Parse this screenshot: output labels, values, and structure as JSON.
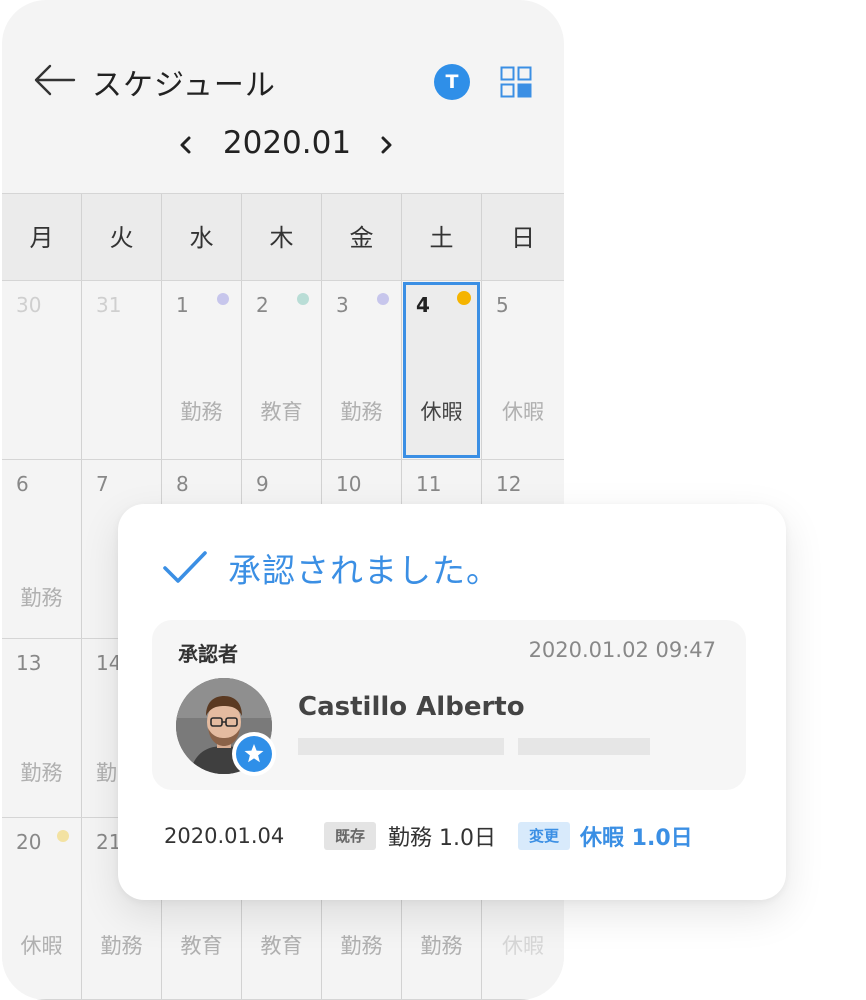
{
  "header": {
    "title": "スケジュール",
    "avatar_letter": "T"
  },
  "month": {
    "label": "2020.01"
  },
  "weekdays": [
    "月",
    "火",
    "水",
    "木",
    "金",
    "土",
    "日"
  ],
  "weeks": [
    {
      "days": [
        {
          "num": "30",
          "label": ""
        },
        {
          "num": "31",
          "label": ""
        },
        {
          "num": "1",
          "label": "勤務",
          "dot": "#c7c6ec"
        },
        {
          "num": "2",
          "label": "教育",
          "dot": "#b9ddd6"
        },
        {
          "num": "3",
          "label": "勤務",
          "dot": "#c7c6ec"
        },
        {
          "num": "4",
          "label": "休暇",
          "dot": "#f5b400",
          "selected": true
        },
        {
          "num": "5",
          "label": "休暇"
        }
      ]
    },
    {
      "days": [
        {
          "num": "6",
          "label": "勤務"
        },
        {
          "num": "7",
          "label": ""
        },
        {
          "num": "8",
          "label": ""
        },
        {
          "num": "9",
          "label": ""
        },
        {
          "num": "10",
          "label": ""
        },
        {
          "num": "11",
          "label": ""
        },
        {
          "num": "12",
          "label": ""
        }
      ]
    },
    {
      "days": [
        {
          "num": "13",
          "label": "勤務"
        },
        {
          "num": "14",
          "label": "勤"
        },
        {
          "num": "",
          "label": ""
        },
        {
          "num": "",
          "label": ""
        },
        {
          "num": "",
          "label": ""
        },
        {
          "num": "",
          "label": ""
        },
        {
          "num": "",
          "label": ""
        }
      ]
    },
    {
      "days": [
        {
          "num": "20",
          "label": "休暇",
          "dot": "#f3e2a2"
        },
        {
          "num": "21",
          "label": "勤務"
        },
        {
          "num": "",
          "label": "教育"
        },
        {
          "num": "",
          "label": "教育"
        },
        {
          "num": "",
          "label": "勤務"
        },
        {
          "num": "",
          "label": "勤務"
        },
        {
          "num": "",
          "label": "休暇"
        }
      ]
    }
  ],
  "card": {
    "title": "承認されました。",
    "approver_label": "承認者",
    "approved_at": "2020.01.02  09:47",
    "approver_name": "Castillo Alberto",
    "change": {
      "date": "2020.01.04",
      "old_tag": "既存",
      "old_value": "勤務 1.0日",
      "new_tag": "変更",
      "new_value": "休暇 1.0日"
    }
  },
  "colors": {
    "accent": "#3b8fe4",
    "background": "#f4f4f4"
  }
}
